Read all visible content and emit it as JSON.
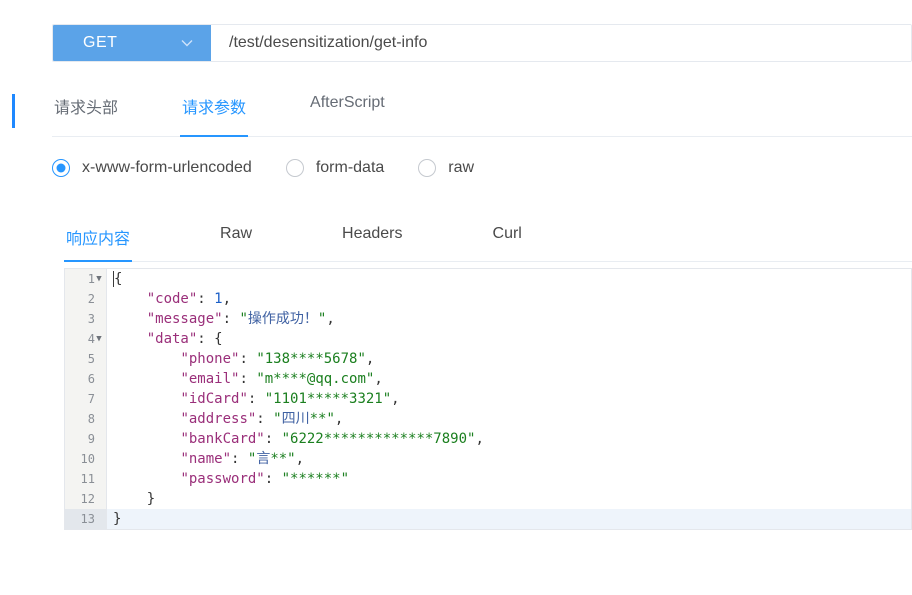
{
  "request": {
    "method": "GET",
    "url": "/test/desensitization/get-info"
  },
  "requestTabs": [
    {
      "label": "请求头部",
      "active": false
    },
    {
      "label": "请求参数",
      "active": true
    },
    {
      "label": "AfterScript",
      "active": false
    }
  ],
  "contentTypes": [
    {
      "label": "x-www-form-urlencoded",
      "checked": true
    },
    {
      "label": "form-data",
      "checked": false
    },
    {
      "label": "raw",
      "checked": false
    }
  ],
  "responseTabs": [
    {
      "label": "响应内容",
      "active": true
    },
    {
      "label": "Raw",
      "active": false
    },
    {
      "label": "Headers",
      "active": false
    },
    {
      "label": "Curl",
      "active": false
    }
  ],
  "editor": {
    "currentLine": 13,
    "foldableLines": [
      1,
      4
    ],
    "lines": [
      [
        {
          "t": "p",
          "v": "{"
        }
      ],
      [
        {
          "t": "p",
          "v": "    "
        },
        {
          "t": "k",
          "v": "\"code\""
        },
        {
          "t": "p",
          "v": ": "
        },
        {
          "t": "n",
          "v": "1"
        },
        {
          "t": "p",
          "v": ","
        }
      ],
      [
        {
          "t": "p",
          "v": "    "
        },
        {
          "t": "k",
          "v": "\"message\""
        },
        {
          "t": "p",
          "v": ": "
        },
        {
          "t": "s",
          "v": "\""
        },
        {
          "t": "cjk",
          "v": "操作成功！"
        },
        {
          "t": "s",
          "v": "\""
        },
        {
          "t": "p",
          "v": ","
        }
      ],
      [
        {
          "t": "p",
          "v": "    "
        },
        {
          "t": "k",
          "v": "\"data\""
        },
        {
          "t": "p",
          "v": ": {"
        }
      ],
      [
        {
          "t": "p",
          "v": "        "
        },
        {
          "t": "k",
          "v": "\"phone\""
        },
        {
          "t": "p",
          "v": ": "
        },
        {
          "t": "s",
          "v": "\"138****5678\""
        },
        {
          "t": "p",
          "v": ","
        }
      ],
      [
        {
          "t": "p",
          "v": "        "
        },
        {
          "t": "k",
          "v": "\"email\""
        },
        {
          "t": "p",
          "v": ": "
        },
        {
          "t": "s",
          "v": "\"m****@qq.com\""
        },
        {
          "t": "p",
          "v": ","
        }
      ],
      [
        {
          "t": "p",
          "v": "        "
        },
        {
          "t": "k",
          "v": "\"idCard\""
        },
        {
          "t": "p",
          "v": ": "
        },
        {
          "t": "s",
          "v": "\"1101*****3321\""
        },
        {
          "t": "p",
          "v": ","
        }
      ],
      [
        {
          "t": "p",
          "v": "        "
        },
        {
          "t": "k",
          "v": "\"address\""
        },
        {
          "t": "p",
          "v": ": "
        },
        {
          "t": "s",
          "v": "\""
        },
        {
          "t": "cjk",
          "v": "四川"
        },
        {
          "t": "s",
          "v": "**\""
        },
        {
          "t": "p",
          "v": ","
        }
      ],
      [
        {
          "t": "p",
          "v": "        "
        },
        {
          "t": "k",
          "v": "\"bankCard\""
        },
        {
          "t": "p",
          "v": ": "
        },
        {
          "t": "s",
          "v": "\"6222*************7890\""
        },
        {
          "t": "p",
          "v": ","
        }
      ],
      [
        {
          "t": "p",
          "v": "        "
        },
        {
          "t": "k",
          "v": "\"name\""
        },
        {
          "t": "p",
          "v": ": "
        },
        {
          "t": "s",
          "v": "\""
        },
        {
          "t": "cjk",
          "v": "言"
        },
        {
          "t": "s",
          "v": "**\""
        },
        {
          "t": "p",
          "v": ","
        }
      ],
      [
        {
          "t": "p",
          "v": "        "
        },
        {
          "t": "k",
          "v": "\"password\""
        },
        {
          "t": "p",
          "v": ": "
        },
        {
          "t": "s",
          "v": "\"******\""
        }
      ],
      [
        {
          "t": "p",
          "v": "    }"
        }
      ],
      [
        {
          "t": "p",
          "v": "}"
        }
      ]
    ]
  }
}
